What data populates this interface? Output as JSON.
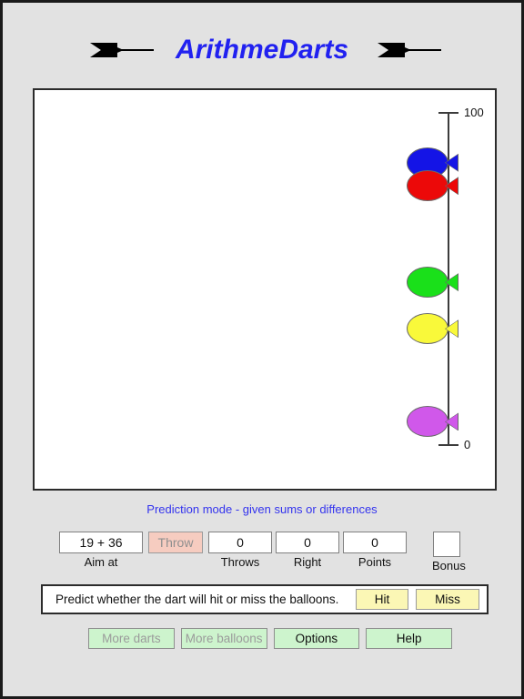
{
  "app": {
    "title": "ArithmeDarts",
    "left_dart_icon": "dart-icon",
    "right_dart_icon": "dart-icon"
  },
  "playfield": {
    "scale": {
      "top_label": "100",
      "bottom_label": "0",
      "min": 0,
      "max": 100
    },
    "balloons": [
      {
        "name": "blue-fish",
        "color": "#1414e6",
        "value": 85
      },
      {
        "name": "red-fish",
        "color": "#ec0909",
        "value": 78
      },
      {
        "name": "green-fish",
        "color": "#1ae01a",
        "value": 49
      },
      {
        "name": "yellow-fish",
        "color": "#f9f93a",
        "value": 35
      },
      {
        "name": "purple-fish",
        "color": "#d058ea",
        "value": 7
      }
    ]
  },
  "mode": {
    "text": "Prediction mode - given sums or differences",
    "color": "#3333ee"
  },
  "stats": {
    "aim": {
      "value": "19 + 36",
      "label": "Aim at"
    },
    "throw": {
      "label": "Throw",
      "enabled": false,
      "color": "#f6ccc0"
    },
    "throws": {
      "value": "0",
      "label": "Throws"
    },
    "right": {
      "value": "0",
      "label": "Right"
    },
    "points": {
      "value": "0",
      "label": "Points"
    },
    "bonus": {
      "value": "",
      "label": "Bonus"
    }
  },
  "predict": {
    "prompt": "Predict whether the dart will hit or miss the balloons.",
    "hit_label": "Hit",
    "miss_label": "Miss",
    "button_color": "#fbf7b5"
  },
  "bottom_buttons": [
    {
      "label": "More darts",
      "enabled": false
    },
    {
      "label": "More balloons",
      "enabled": false
    },
    {
      "label": "Options",
      "enabled": true
    },
    {
      "label": "Help",
      "enabled": true
    }
  ]
}
